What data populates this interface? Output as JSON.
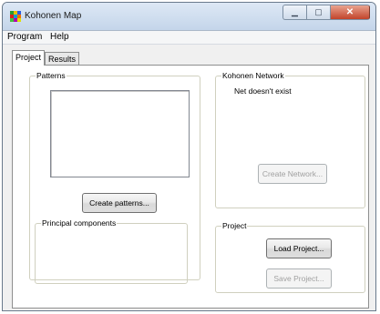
{
  "window": {
    "title": "Kohonen Map",
    "controls": {
      "minimize": "▁",
      "maximize": "▢",
      "close": "✕"
    }
  },
  "menu": {
    "items": [
      "Program",
      "Help"
    ]
  },
  "tabs": [
    {
      "label": "Project",
      "active": true
    },
    {
      "label": "Results",
      "active": false
    }
  ],
  "patterns": {
    "group_label": "Patterns",
    "create_button": "Create patterns..."
  },
  "principal": {
    "group_label": "Principal components"
  },
  "network": {
    "group_label": "Kohonen Network",
    "status": "Net doesn't exist",
    "create_button": "Create Network..."
  },
  "project": {
    "group_label": "Project",
    "load_button": "Load Project...",
    "save_button": "Save Project..."
  },
  "colors": {
    "icon_cells": [
      "#2a9b2f",
      "#e8c000",
      "#2b5ce0",
      "#d82020",
      "#00a0d0",
      "#f07000",
      "#40c040",
      "#b000b0",
      "#e0e000"
    ]
  }
}
